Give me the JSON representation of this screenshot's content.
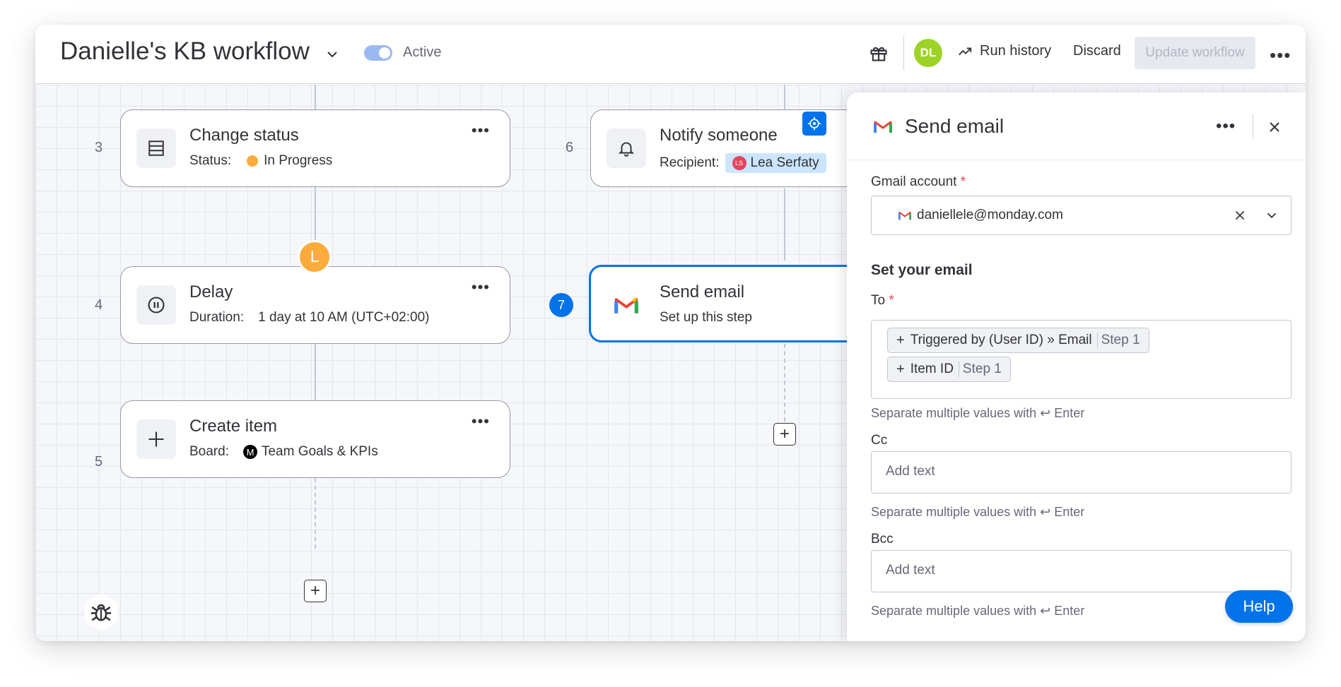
{
  "header": {
    "title": "Danielle's KB workflow",
    "toggle_label": "Active",
    "avatar_initials": "DL",
    "run_history": "Run history",
    "discard": "Discard",
    "update_workflow": "Update workflow"
  },
  "nodes": [
    {
      "num": "3",
      "title": "Change status",
      "sub_label": "Status:",
      "sub_value": "In Progress"
    },
    {
      "num": "4",
      "title": "Delay",
      "sub_label": "Duration:",
      "sub_value": "1 day at 10 AM (UTC+02:00)",
      "badge": "L"
    },
    {
      "num": "5",
      "title": "Create item",
      "sub_label": "Board:",
      "sub_value": "Team Goals & KPIs",
      "badge": "M"
    },
    {
      "num": "6",
      "title": "Notify someone",
      "sub_label": "Recipient:",
      "sub_value": "Lea Serfaty",
      "badge": "LS"
    },
    {
      "num": "7",
      "title": "Send email",
      "sub_value": "Set up this step"
    }
  ],
  "panel": {
    "title": "Send email",
    "gmail_label": "Gmail account",
    "required_mark": "*",
    "gmail_value": "daniellele@monday.com",
    "section_title": "Set your email",
    "to_label": "To",
    "chips": [
      {
        "label": "Triggered by (User ID) » Email",
        "step": "Step 1"
      },
      {
        "label": "Item ID",
        "step": "Step 1"
      }
    ],
    "hint": "Separate multiple values with ↩ Enter",
    "cc_label": "Cc",
    "bcc_label": "Bcc",
    "placeholder": "Add text"
  },
  "help": "Help",
  "colors": {
    "primary": "#0073ea",
    "status_in_progress": "#fdab3d",
    "avatar_green": "#9cd326"
  },
  "icons": [
    "chevron-down-icon",
    "gift-icon",
    "trend-up-icon",
    "more-icon",
    "table-icon",
    "pause-icon",
    "plus-icon",
    "bell-icon",
    "gmail-icon",
    "target-icon",
    "bug-icon",
    "close-icon"
  ]
}
